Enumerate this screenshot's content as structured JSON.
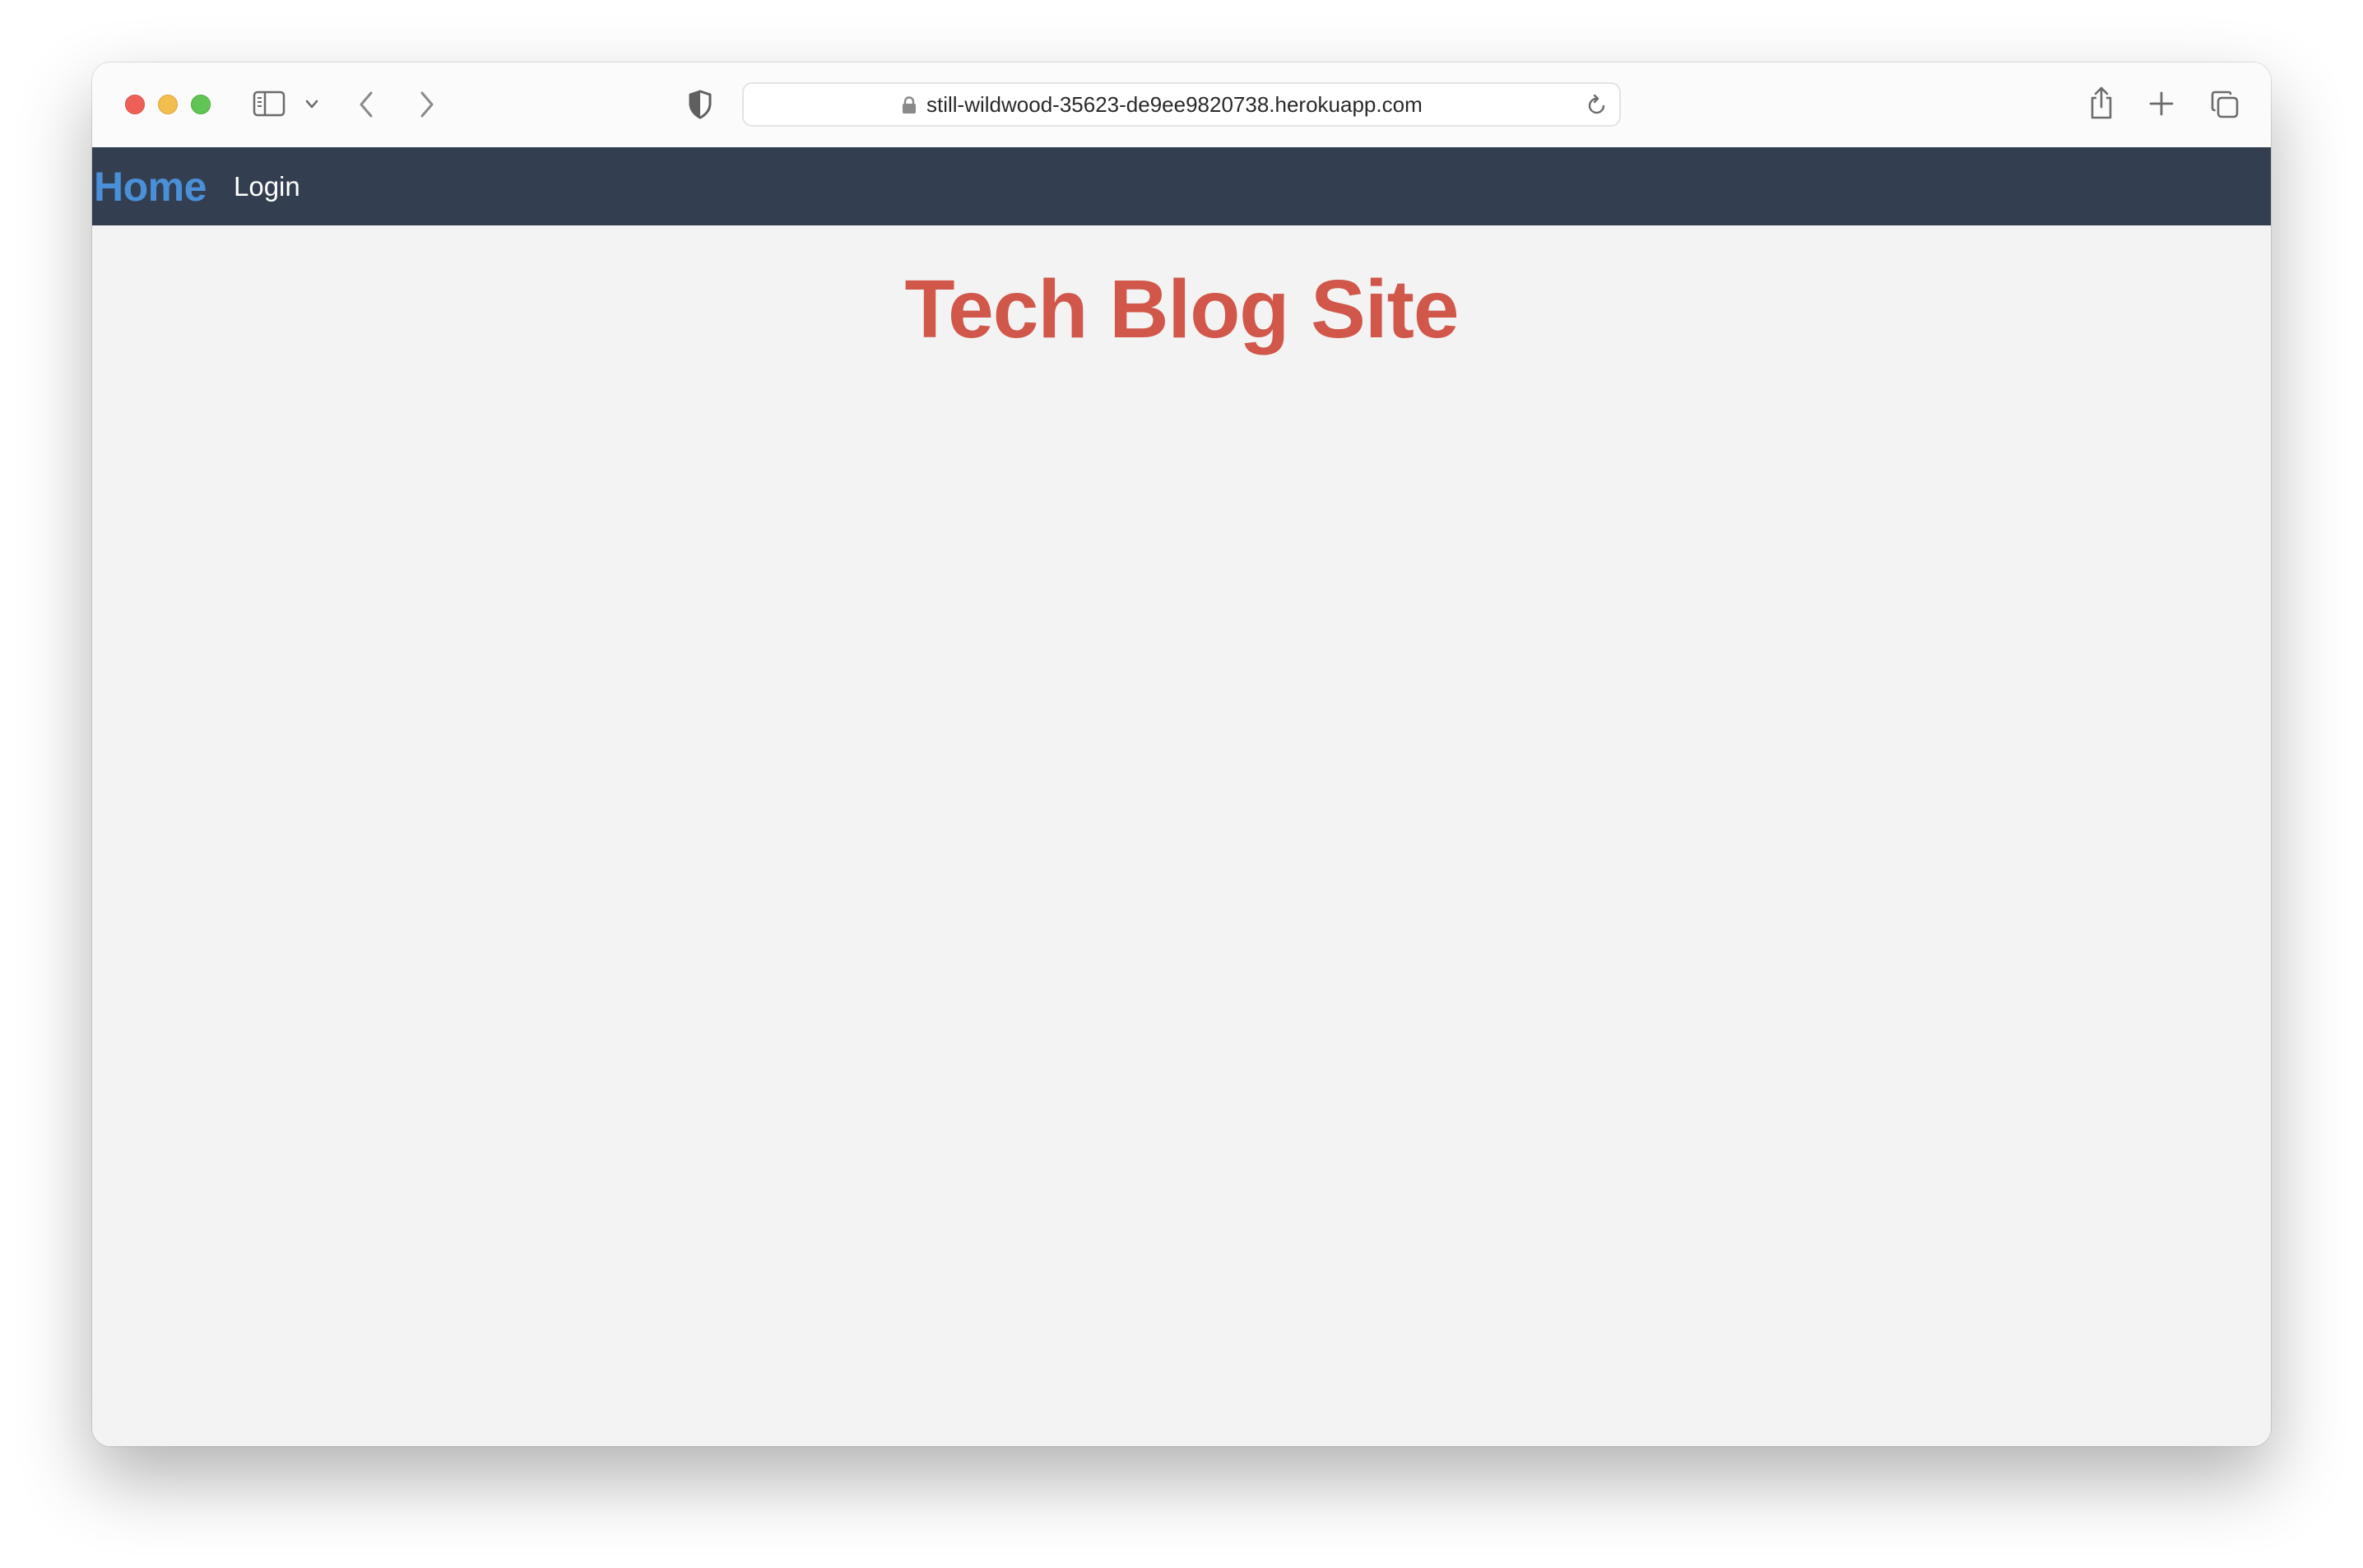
{
  "browser": {
    "url": "still-wildwood-35623-de9ee9820738.herokuapp.com",
    "icons": {
      "close": "close-window-icon",
      "minimize": "minimize-window-icon",
      "zoom": "zoom-window-icon",
      "sidebar": "sidebar-icon",
      "sidebar_menu": "chevron-down-icon",
      "back": "chevron-left-icon",
      "forward": "chevron-right-icon",
      "privacy": "shield-icon",
      "lock": "lock-icon",
      "reload": "reload-icon",
      "share": "share-icon",
      "new_tab": "plus-icon",
      "tabs": "tab-overview-icon"
    }
  },
  "nav": {
    "home_label": "Home",
    "login_label": "Login"
  },
  "page": {
    "title": "Tech Blog Site"
  },
  "colors": {
    "navbar_bg": "#333f50",
    "home_link": "#4a90d9",
    "title": "#d0574a",
    "page_bg": "#f3f3f3"
  }
}
